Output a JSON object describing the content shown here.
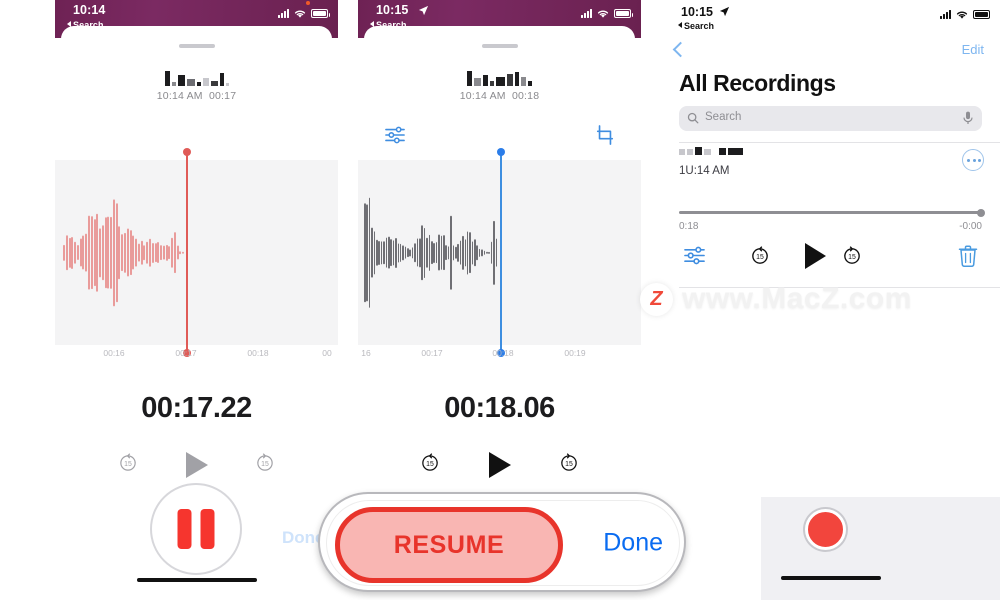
{
  "panels": [
    {
      "id": "recording-paused",
      "status": {
        "time": "10:14",
        "back_label": "Search",
        "location_icon": "location-arrow-icon",
        "signal": "signal-bars-icon",
        "wifi": "wifi-icon",
        "battery": "battery-icon"
      },
      "title_pixelated": "redacted-recording-name",
      "meta_time": "10:14 AM",
      "meta_duration": "00:17",
      "axis_labels": [
        "00:16",
        "00:17",
        "00:18",
        "00"
      ],
      "playhead_label": "00:17",
      "big_time": "00:17.22",
      "controls": {
        "back15": "15",
        "play": "play-icon",
        "forward15": "15",
        "main": "pause-icon",
        "done": "Done"
      },
      "accent": "#f6352e"
    },
    {
      "id": "recording-resumable",
      "status": {
        "time": "10:15",
        "back_label": "Search",
        "location_icon": "location-arrow-icon",
        "signal": "signal-bars-icon",
        "wifi": "wifi-icon",
        "battery": "battery-icon"
      },
      "title_pixelated": "redacted-recording-name",
      "meta_time": "10:14 AM",
      "meta_duration": "00:18",
      "tools": {
        "left": "audio-sliders-icon",
        "right": "crop-trim-icon"
      },
      "axis_labels": [
        "16",
        "00:17",
        "00:18",
        "00:19"
      ],
      "playhead_label": "00:18",
      "big_time": "00:18.06",
      "controls": {
        "back15": "15",
        "play": "play-icon",
        "forward15": "15"
      },
      "accent": "#2b7de9"
    },
    {
      "id": "all-recordings-list",
      "status": {
        "time": "10:15",
        "back_label": "Search",
        "location_icon": "location-arrow-icon",
        "signal": "signal-bars-icon",
        "wifi": "wifi-icon",
        "battery": "battery-icon"
      },
      "nav": {
        "back_icon": "chevron-left-icon",
        "edit_label": "Edit"
      },
      "page_title": "All Recordings",
      "search": {
        "placeholder": "Search",
        "icon": "search-icon",
        "mic_icon": "microphone-icon"
      },
      "recording": {
        "title_pixelated": "redacted-recording-name",
        "subtitle": "1U:14 AM",
        "more_icon": "ellipsis-circle-icon",
        "elapsed": "0:18",
        "remaining": "-0:00",
        "controls": {
          "sliders": "audio-sliders-icon",
          "back15": "15",
          "play": "play-icon",
          "forward15": "15",
          "trash": "trash-icon"
        }
      }
    }
  ],
  "overlay": {
    "resume_label": "RESUME",
    "done_label": "Done",
    "record_button": "record-button",
    "resume_color": "#e8342b",
    "resume_fill": "#f9b6b3",
    "done_color": "#0a6cf1"
  },
  "watermark": {
    "badge": "Z",
    "text": "www.MacZ.com"
  },
  "ghost_done": "Done"
}
